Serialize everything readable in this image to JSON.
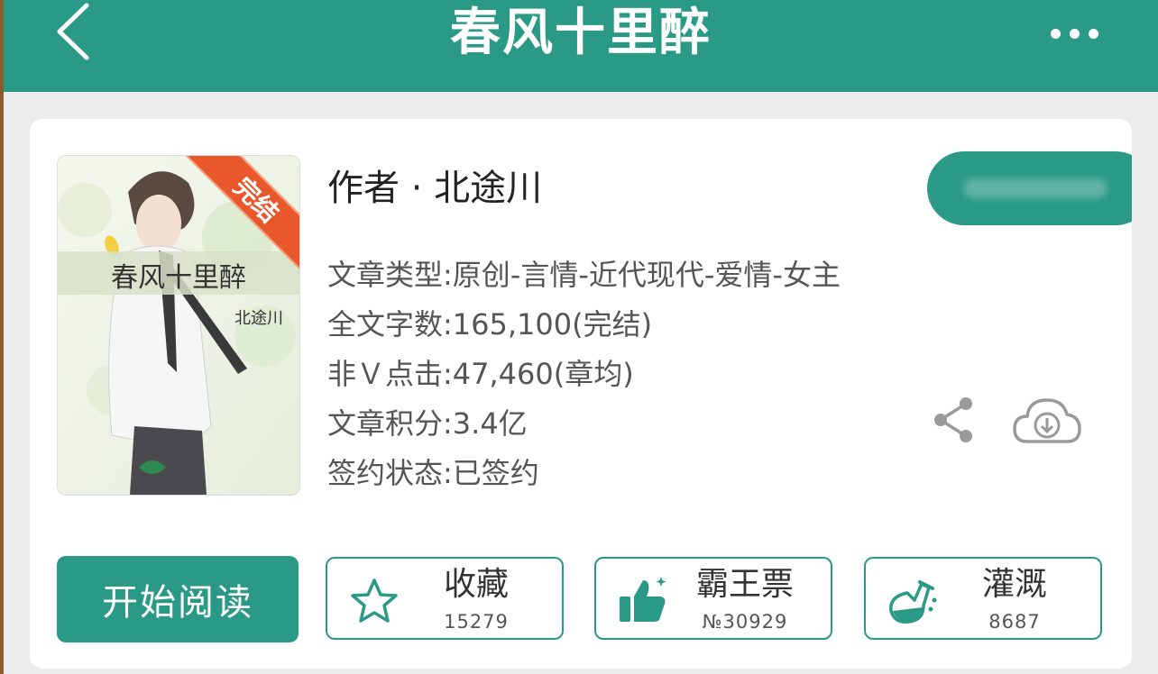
{
  "header": {
    "title": "春风十里醉"
  },
  "book": {
    "cover_title": "春风十里醉",
    "cover_author": "北途川",
    "status_ribbon": "完结",
    "author_line": "作者 · 北途川",
    "info": [
      "文章类型:原创-言情-近代现代-爱情-女主",
      "全文字数:165,100(完结)",
      "非Ｖ点击:47,460(章均)",
      "文章积分:3.4亿",
      "签约状态:已签约"
    ]
  },
  "actions": {
    "read": "开始阅读",
    "favorite": {
      "label": "收藏",
      "count": "15279"
    },
    "vote": {
      "label": "霸王票",
      "count": "№30929"
    },
    "water": {
      "label": "灌溉",
      "count": "8687"
    }
  },
  "colors": {
    "accent": "#2a9a86",
    "ribbon": "#e8572b"
  },
  "icons": [
    "back-icon",
    "more-icon",
    "share-icon",
    "cloud-download-icon",
    "star-icon",
    "thumbs-up-icon",
    "flask-icon"
  ]
}
